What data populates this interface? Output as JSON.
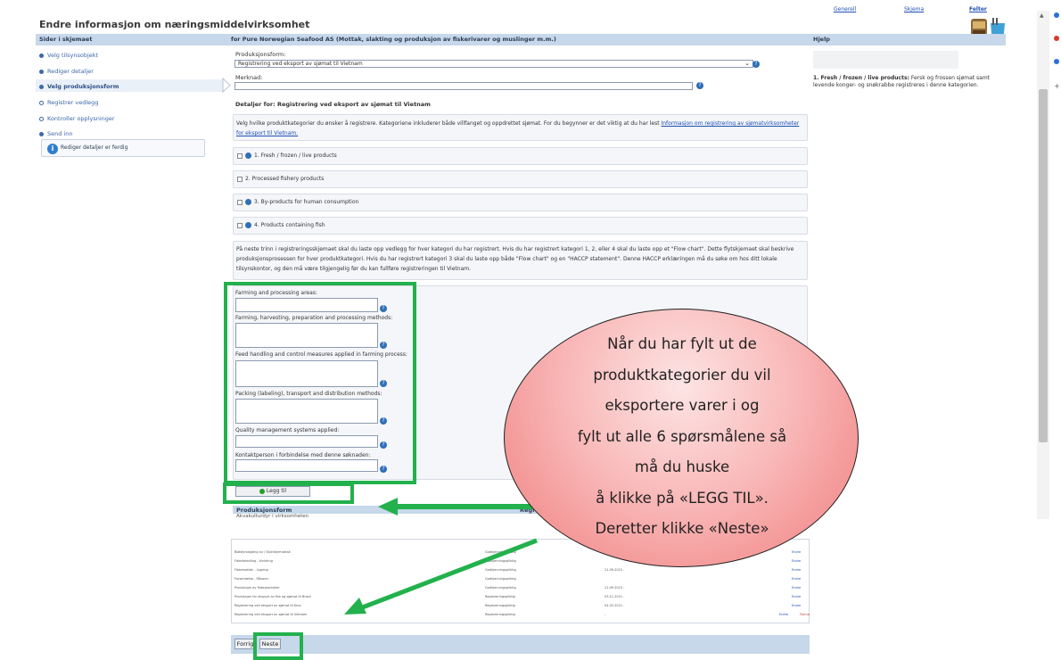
{
  "page_title": "Endre informasjon om næringsmiddelvirksomhet",
  "left_nav": {
    "header": "Sider i skjemaet",
    "items": [
      {
        "label": "Velg tilsynsobjekt",
        "state": "done"
      },
      {
        "label": "Rediger detaljer",
        "state": "done"
      },
      {
        "label": "Velg produksjonsform",
        "state": "active"
      },
      {
        "label": "Registrer vedlegg",
        "state": "pending"
      },
      {
        "label": "Kontroller opplysninger",
        "state": "pending"
      },
      {
        "label": "Send inn",
        "state": "done"
      }
    ],
    "info_message": "Rediger detaljer er ferdig"
  },
  "main": {
    "header": "for Pure Norwegian Seafood AS (Mottak, slakting og produksjon av fiskerivarer og muslinger m.m.)",
    "production_form_label": "Produksjonsform:",
    "production_form_value": "Registrering ved eksport av sjømat til Vietnam",
    "remark_label": "Merknad:",
    "details_title": "Detaljer for: Registrering ved eksport av sjømat til Vietnam",
    "intro_text": "Velg hvilke produktkategorier du ønsker å registrere. Kategoriene inkluderer både villfanget og oppdrettet sjømat. For du begynner er det viktig at du har lest ",
    "intro_link": "Informasjon om registrering av sjømatvirksomheter for eksport til Vietnam.",
    "categories": [
      {
        "label": "1. Fresh / frozen / live products",
        "has_help": true
      },
      {
        "label": "2. Processed fishery products",
        "has_help": false
      },
      {
        "label": "3. By-products for human consumption",
        "has_help": true
      },
      {
        "label": "4. Products containing fish",
        "has_help": true
      }
    ],
    "upload_text": "På neste trinn i registreringsskjemaet skal du laste opp vedlegg for hver kategori du har registrert. Hvis du har registrert kategori 1, 2, eller 4 skal du laste opp et \"Flow chart\". Dette flytskjemaet skal beskrive produksjonsprosessen for hver produktkategori. Hvis du har registrert kategori 3 skal du laste opp både \"Flow chart\" og en \"HACCP statement\". Denne HACCP erklæringen må du søke om hos ditt lokale tilsynskontor, og den må være tilgjengelig før du kan fullføre registreringen til Vietnam.",
    "fields": [
      "Farming and processing areas:",
      "Farming, harvesting, preparation and processing methods:",
      "Feed handling and control measures applied in farming process:",
      "Packing (labeling), transport and distribution methods:",
      "Quality management systems applied:",
      "Kontaktperson i forbindelse med denne søknaden:"
    ],
    "add_button": "Legg til",
    "table_header_left": "Produksjonsform",
    "table_header_right": "Regi",
    "table_first_row": "Akvakulturdyr i virksomheten"
  },
  "lower_table": {
    "rows": [
      {
        "a": "Bløtdyrslagting av / Skjelldyrmottak",
        "b": "Godkjenningspliktig",
        "c": "",
        "d": "Endre"
      },
      {
        "a": "Fiskeforedling - tilvirking",
        "b": "Godkjenningspliktig",
        "c": "",
        "d": "Endre"
      },
      {
        "a": "Fiskemottak - Lagring",
        "b": "Godkjenningspliktig",
        "c": "21.09.2015 -",
        "d": "Endre"
      },
      {
        "a": "Forsendelse - Råvarer",
        "b": "Godkjenningspliktig",
        "c": "",
        "d": "Endre"
      },
      {
        "a": "Produksjon av fiskeprodukter",
        "b": "Godkjenningspliktig",
        "c": "21.09.2015 -",
        "d": "Endre"
      },
      {
        "a": "Produksjon for eksport av fisk og sjømat til Brasil",
        "b": "Registreringspliktig",
        "c": "03.11.2021 -",
        "d": "Endre"
      },
      {
        "a": "Registrering ved eksport av sjømat til Kina",
        "b": "Registreringspliktig",
        "c": "04.03.2021 -",
        "d": "Endre"
      },
      {
        "a": "Registrering ved eksport av sjømat til Vietnam",
        "b": "Registreringspliktig",
        "c": "",
        "d": "Endre",
        "e": "Fjerne"
      }
    ]
  },
  "bottom_nav": {
    "prev_label": "Forrig",
    "next_label": "Neste"
  },
  "help": {
    "header": "Hjelp",
    "tabs": [
      "Generell",
      "Skjema",
      "Felter"
    ],
    "active_tab": "Felter",
    "text_bold": "1. Fresh / frozen / live products:",
    "text": " Fersk og frossen sjømat samt levende konger- og snøkrabbe registreres i denne kategorien."
  },
  "callout": {
    "lines": [
      "Når du har fylt ut de",
      "produktkategorier du vil",
      "eksportere varer i og",
      "fylt ut alle 6 spørsmålene så",
      "må du huske",
      "å klikke på «LEGG TIL».",
      "Deretter klikke «Neste»"
    ]
  },
  "colors": {
    "highlight": "#22b14c",
    "header_blue": "#c6d8ea",
    "link": "#1f4fb5"
  }
}
